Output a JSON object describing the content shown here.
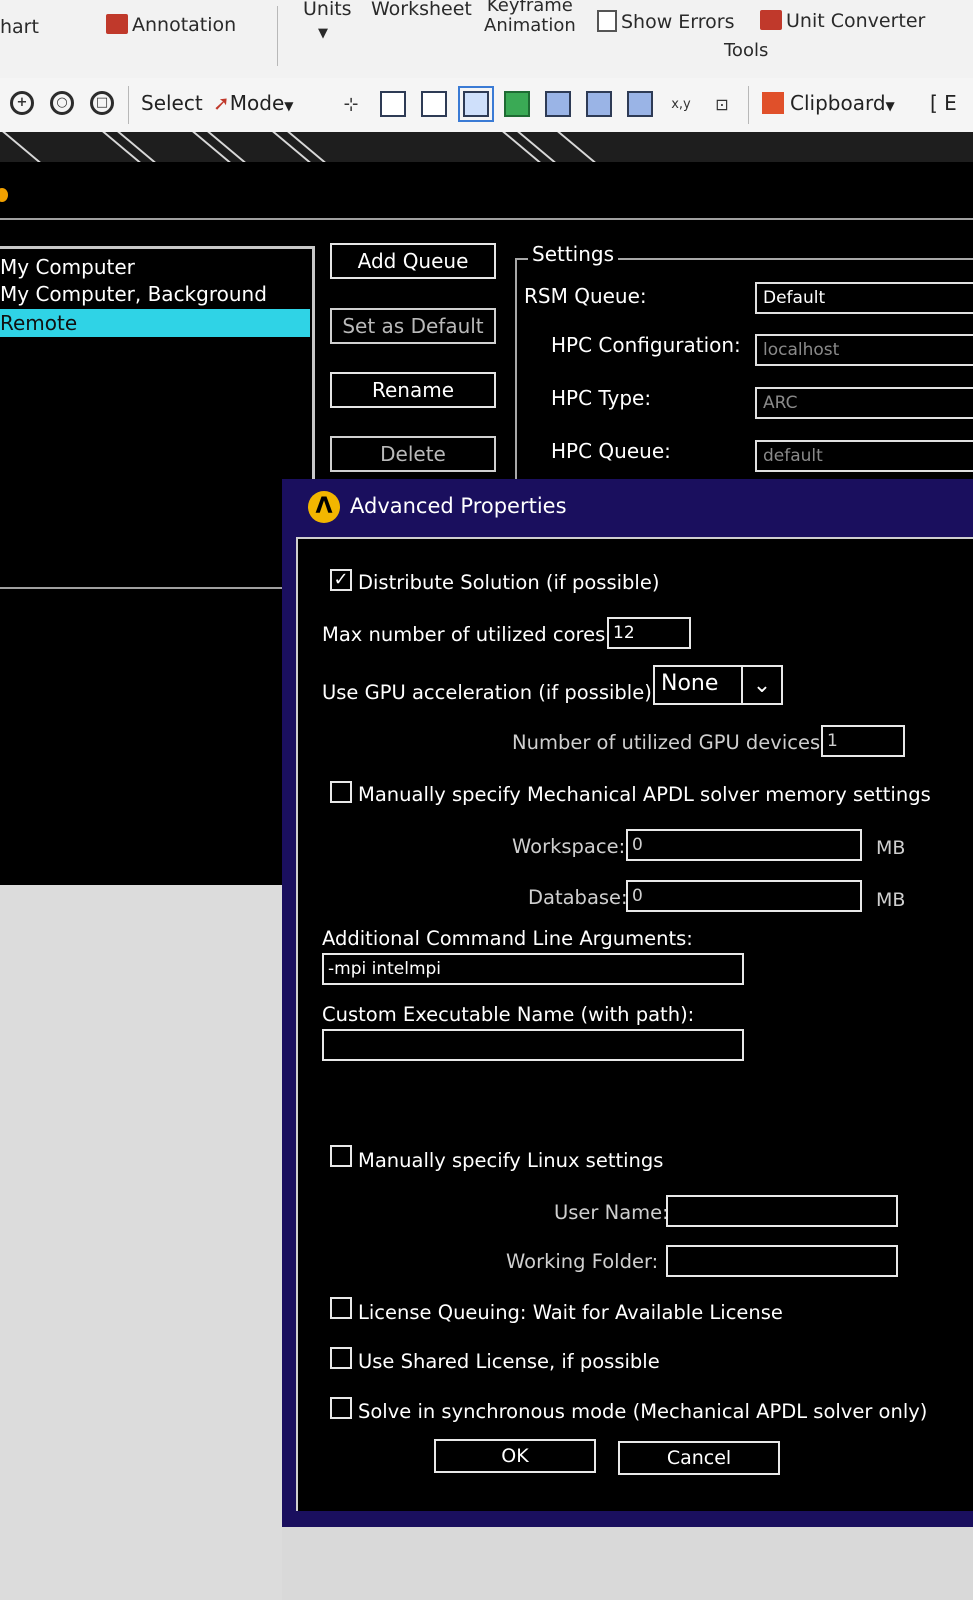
{
  "ribbon": {
    "chart_label": "hart",
    "annotation_label": "Annotation",
    "units_label": "Units",
    "worksheet_label": "Worksheet",
    "keyframe_label": "Keyframe",
    "animation_label": "Animation",
    "show_errors_label": "Show Errors",
    "unit_converter_label": "Unit Converter",
    "tools_group_label": "Tools"
  },
  "toolbar": {
    "select_label": "Select",
    "mode_label": "Mode",
    "clipboard_label": "Clipboard",
    "trailing_label": "[ E"
  },
  "queue_window": {
    "queues": [
      {
        "label": "My Computer",
        "selected": false
      },
      {
        "label": "My Computer, Background",
        "selected": false
      },
      {
        "label": "Remote",
        "selected": true
      }
    ],
    "buttons": {
      "add_queue": "Add Queue",
      "set_as_default": "Set as Default",
      "rename": "Rename",
      "delete": "Delete"
    },
    "settings": {
      "legend": "Settings",
      "rsm_queue_label": "RSM Queue:",
      "rsm_queue_value": "Default",
      "hpc_config_label": "HPC Configuration:",
      "hpc_config_value": "localhost",
      "hpc_type_label": "HPC Type:",
      "hpc_type_value": "ARC",
      "hpc_queue_label": "HPC Queue:",
      "hpc_queue_value": "default"
    }
  },
  "advanced": {
    "title": "Advanced Properties",
    "logo_text": "Λ",
    "distribute_label": "Distribute Solution (if possible)",
    "distribute_checked": true,
    "max_cores_label": "Max number of utilized cores:",
    "max_cores_value": "12",
    "gpu_accel_label": "Use GPU acceleration (if possible)",
    "gpu_accel_value": "None",
    "gpu_devices_label": "Number of utilized GPU devices:",
    "gpu_devices_value": "1",
    "manual_memory_label": "Manually specify Mechanical APDL solver memory settings",
    "manual_memory_checked": false,
    "workspace_label": "Workspace:",
    "workspace_value": "0",
    "workspace_unit": "MB",
    "database_label": "Database:",
    "database_value": "0",
    "database_unit": "MB",
    "cmd_args_label": "Additional Command Line Arguments:",
    "cmd_args_value": "-mpi intelmpi",
    "exe_name_label": "Custom Executable Name (with path):",
    "exe_name_value": "",
    "linux_label": "Manually specify Linux settings",
    "linux_checked": false,
    "user_name_label": "User Name:",
    "user_name_value": "",
    "working_folder_label": "Working Folder:",
    "working_folder_value": "",
    "license_queuing_label": "License Queuing: Wait for Available License",
    "license_queuing_checked": false,
    "shared_license_label": "Use Shared License, if possible",
    "shared_license_checked": false,
    "sync_mode_label": "Solve in synchronous mode (Mechanical APDL solver only)",
    "sync_mode_checked": false,
    "ok_label": "OK",
    "cancel_label": "Cancel"
  },
  "colors": {
    "selection": "#2fd3e6",
    "dialog_frame": "#1a0f5e",
    "logo": "#f2b600"
  }
}
